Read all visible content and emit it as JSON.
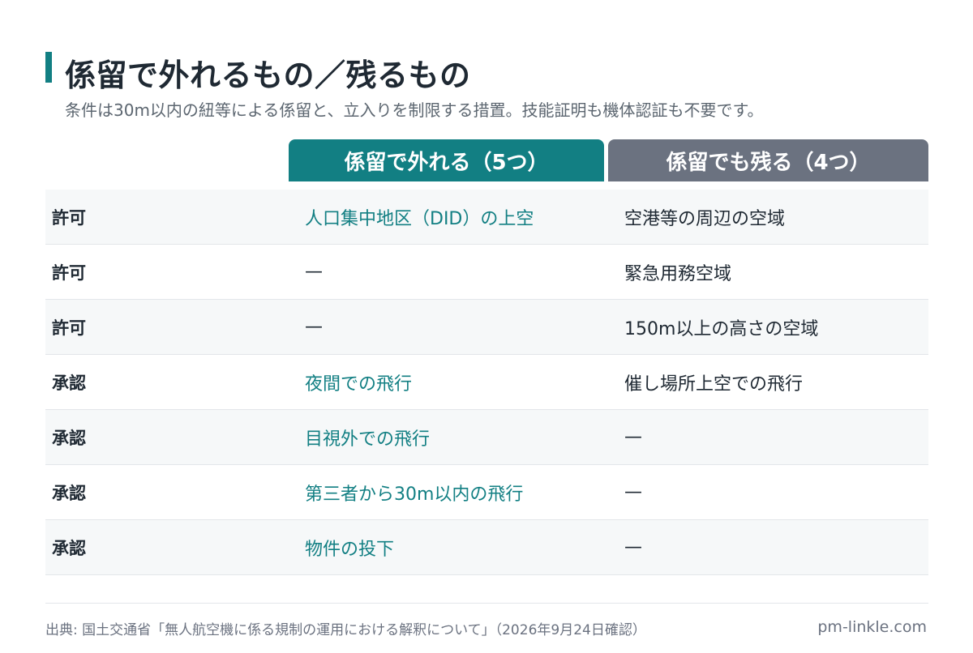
{
  "header": {
    "title": "係留で外れるもの／残るもの",
    "subtitle": "条件は30m以内の紐等による係留と、立入りを制限する措置。技能証明も機体認証も不要です。"
  },
  "columns": {
    "lifted": "係留で外れる（5つ）",
    "remains": "係留でも残る（4つ）"
  },
  "rows": [
    {
      "type": "許可",
      "lifted": "人口集中地区（DID）の上空",
      "remains": "空港等の周辺の空域"
    },
    {
      "type": "許可",
      "lifted": "—",
      "remains": "緊急用務空域"
    },
    {
      "type": "許可",
      "lifted": "—",
      "remains": "150m以上の高さの空域"
    },
    {
      "type": "承認",
      "lifted": "夜間での飛行",
      "remains": "催し場所上空での飛行"
    },
    {
      "type": "承認",
      "lifted": "目視外での飛行",
      "remains": "—"
    },
    {
      "type": "承認",
      "lifted": "第三者から30m以内の飛行",
      "remains": "—"
    },
    {
      "type": "承認",
      "lifted": "物件の投下",
      "remains": "—"
    }
  ],
  "footer": {
    "source": "出典: 国土交通省「無人航空機に係る規制の運用における解釈について」（2026年9月24日確認）",
    "site": "pm-linkle.com"
  },
  "colors": {
    "accent": "#127f83",
    "secondary": "#6b7280"
  }
}
